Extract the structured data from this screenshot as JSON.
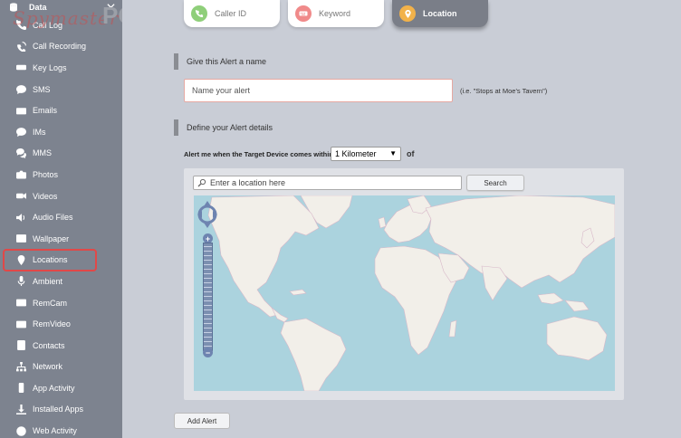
{
  "sidebar": {
    "header": "Data",
    "items": [
      {
        "label": "Call Log",
        "icon": "phone-icon"
      },
      {
        "label": "Call Recording",
        "icon": "phone-wave-icon"
      },
      {
        "label": "Key Logs",
        "icon": "keyboard-icon"
      },
      {
        "label": "SMS",
        "icon": "chat-bubble-icon"
      },
      {
        "label": "Emails",
        "icon": "envelope-icon"
      },
      {
        "label": "IMs",
        "icon": "chat-dots-icon"
      },
      {
        "label": "MMS",
        "icon": "chat-multi-icon"
      },
      {
        "label": "Photos",
        "icon": "camera-icon"
      },
      {
        "label": "Videos",
        "icon": "video-camera-icon"
      },
      {
        "label": "Audio Files",
        "icon": "speaker-icon"
      },
      {
        "label": "Wallpaper",
        "icon": "image-icon"
      },
      {
        "label": "Locations",
        "icon": "map-pin-icon"
      },
      {
        "label": "Ambient",
        "icon": "microphone-icon"
      },
      {
        "label": "RemCam",
        "icon": "remcam-icon"
      },
      {
        "label": "RemVideo",
        "icon": "remvideo-icon"
      },
      {
        "label": "Contacts",
        "icon": "contacts-icon"
      },
      {
        "label": "Network",
        "icon": "network-icon"
      },
      {
        "label": "App Activity",
        "icon": "mobile-icon"
      },
      {
        "label": "Installed Apps",
        "icon": "download-icon"
      },
      {
        "label": "Web Activity",
        "icon": "globe-icon"
      }
    ],
    "selected": "Locations"
  },
  "watermark": {
    "text": "Spymaster",
    "suffix": "PC"
  },
  "tabs": [
    {
      "label": "Caller ID",
      "icon": "phone-icon",
      "color": "#8fcf7a"
    },
    {
      "label": "Keyword",
      "icon": "keyboard-icon",
      "color": "#f08a8a"
    },
    {
      "label": "Location",
      "icon": "map-pin-icon",
      "color": "#f2b24a"
    }
  ],
  "form": {
    "name_section": "Give this Alert a name",
    "name_placeholder": "Name your alert",
    "name_hint": "(i.e. \"Stops at Moe's Tavern\")",
    "details_section": "Define your Alert details",
    "within_label": "Alert me when the Target Device comes within:",
    "distance_selected": "1 Kilometer",
    "of_label": "of",
    "location_placeholder": "Enter a location here",
    "search_button": "Search",
    "add_button": "Add Alert"
  },
  "colors": {
    "sidebar_bg": "#7d838f",
    "highlight": "#e14848",
    "ocean": "#abd3de",
    "land": "#f2efe9"
  }
}
